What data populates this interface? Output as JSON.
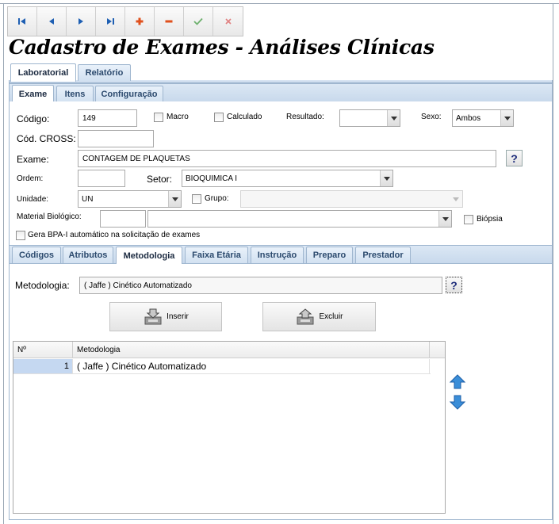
{
  "toolbar": {
    "buttons": [
      {
        "name": "first",
        "icon": "first-record-icon"
      },
      {
        "name": "prior",
        "icon": "prior-record-icon"
      },
      {
        "name": "next",
        "icon": "next-record-icon"
      },
      {
        "name": "last",
        "icon": "last-record-icon"
      },
      {
        "name": "insert",
        "icon": "plus-icon"
      },
      {
        "name": "delete",
        "icon": "minus-icon"
      },
      {
        "name": "post",
        "icon": "check-icon"
      },
      {
        "name": "cancel",
        "icon": "cancel-x-icon"
      }
    ],
    "colors": {
      "arrows": "#1e5fb3",
      "plus": "#e0501c",
      "minus": "#e0501c",
      "check": "#6db06d",
      "cancel": "#e08080"
    }
  },
  "page_title": "Cadastro de Exames - Análises Clínicas",
  "main_tabs": [
    "Laboratorial",
    "Relatório"
  ],
  "sub_tabs": [
    "Exame",
    "Itens",
    "Configuração"
  ],
  "form": {
    "codigo_label": "Código:",
    "codigo_value": "149",
    "macro_label": "Macro",
    "calculado_label": "Calculado",
    "resultado_label": "Resultado:",
    "resultado_value": "",
    "sexo_label": "Sexo:",
    "sexo_value": "Ambos",
    "cod_cross_label": "Cód. CROSS:",
    "cod_cross_value": "",
    "exame_label": "Exame:",
    "exame_value": "CONTAGEM DE PLAQUETAS",
    "help_label": "?",
    "ordem_label": "Ordem:",
    "ordem_value": "",
    "setor_label": "Setor:",
    "setor_value": "BIOQUIMICA I",
    "unidade_label": "Unidade:",
    "unidade_value": "UN",
    "grupo_label": "Grupo:",
    "grupo_value": "",
    "material_label": "Material Biológico:",
    "material_code": "",
    "material_value": "",
    "biopsia_label": "Biópsia",
    "bpa_label": "Gera BPA-I automático na solicitação de exames"
  },
  "detail_tabs": [
    "Códigos",
    "Atributos",
    "Metodologia",
    "Faixa Etária",
    "Instrução",
    "Preparo",
    "Prestador"
  ],
  "metodologia": {
    "label": "Metodologia:",
    "value": "( Jaffe ) Cinético Automatizado",
    "help_label": "?",
    "inserir_label": "Inserir",
    "excluir_label": "Excluir",
    "grid_headers": [
      "Nº",
      "Metodologia"
    ],
    "rows": [
      {
        "num": "1",
        "metodologia": "( Jaffe ) Cinético Automatizado"
      }
    ],
    "selection_color": "#c5d8f1"
  }
}
